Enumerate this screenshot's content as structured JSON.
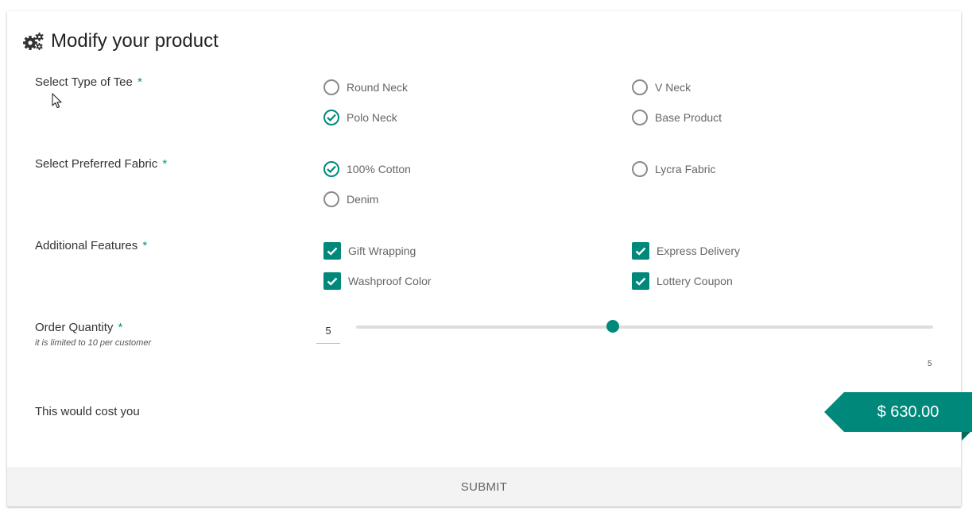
{
  "header": {
    "title": "Modify your product",
    "icon": "gears-icon"
  },
  "tee_type": {
    "label": "Select Type of Tee",
    "required_mark": "*",
    "options": [
      {
        "label": "Round Neck",
        "selected": false
      },
      {
        "label": "V Neck",
        "selected": false
      },
      {
        "label": "Polo Neck",
        "selected": true
      },
      {
        "label": "Base Product",
        "selected": false
      }
    ]
  },
  "fabric": {
    "label": "Select Preferred Fabric",
    "required_mark": "*",
    "options": [
      {
        "label": "100% Cotton",
        "selected": true
      },
      {
        "label": "Lycra Fabric",
        "selected": false
      },
      {
        "label": "Denim",
        "selected": false
      }
    ]
  },
  "features": {
    "label": "Additional Features",
    "required_mark": "*",
    "options": [
      {
        "label": "Gift Wrapping",
        "checked": true
      },
      {
        "label": "Express Delivery",
        "checked": true
      },
      {
        "label": "Washproof Color",
        "checked": true
      },
      {
        "label": "Lottery Coupon",
        "checked": true
      }
    ]
  },
  "quantity": {
    "label": "Order Quantity",
    "required_mark": "*",
    "hint": "it is limited to 10 per customer",
    "input_value": "5",
    "slider_value": 5,
    "slider_max": 10,
    "slider_value_label": "5"
  },
  "cost": {
    "label": "This would cost you",
    "amount": "$ 630.00"
  },
  "submit_label": "SUBMIT",
  "colors": {
    "accent": "#00897b",
    "accent_dark": "#00695c",
    "submit_bg": "#f3f3f3"
  }
}
